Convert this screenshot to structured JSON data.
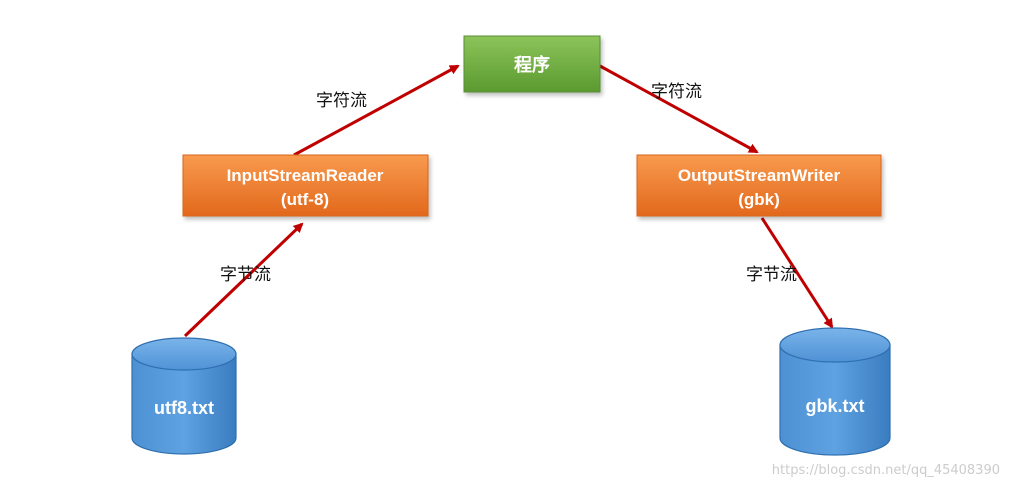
{
  "nodes": {
    "program": "程序",
    "reader_title": "InputStreamReader",
    "reader_encoding": "(utf-8)",
    "writer_title": "OutputStreamWriter",
    "writer_encoding": "(gbk)",
    "source_file": "utf8.txt",
    "target_file": "gbk.txt"
  },
  "edges": {
    "source_to_reader": "字节流",
    "reader_to_program": "字符流",
    "program_to_writer": "字符流",
    "writer_to_target": "字节流"
  },
  "watermark": "https://blog.csdn.net/qq_45408390",
  "colors": {
    "program_box": "#6aaa3c",
    "stream_box": "#ec7424",
    "cylinder": "#3a82c8",
    "arrow": "#c00000"
  }
}
